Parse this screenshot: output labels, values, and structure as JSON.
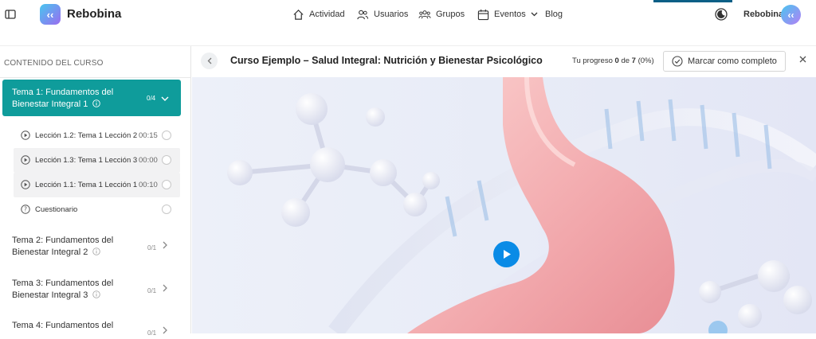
{
  "header": {
    "brand": "Rebobina",
    "nav": [
      {
        "label": "Actividad",
        "icon": "home-icon"
      },
      {
        "label": "Usuarios",
        "icon": "users-icon"
      },
      {
        "label": "Grupos",
        "icon": "groups-icon"
      },
      {
        "label": "Eventos",
        "icon": "calendar-icon"
      },
      {
        "label": "Blog",
        "icon": ""
      }
    ],
    "user_name": "Rebobina"
  },
  "sidebar": {
    "title": "CONTENIDO DEL CURSO",
    "active_topic": {
      "title": "Tema 1: Fundamentos del Bienestar Integral 1",
      "count": "0/4"
    },
    "lessons": [
      {
        "label": "Lección 1.2: Tema 1 Lección 2",
        "duration": "00:15"
      },
      {
        "label": "Lección 1.3: Tema 1 Lección 3",
        "duration": "00:00"
      },
      {
        "label": "Lección 1.1: Tema 1 Lección 1",
        "duration": "00:10"
      },
      {
        "label": "Cuestionario",
        "duration": ""
      }
    ],
    "topics": [
      {
        "title": "Tema 2: Fundamentos del Bienestar Integral 2",
        "count": "0/1"
      },
      {
        "title": "Tema 3: Fundamentos del Bienestar Integral 3",
        "count": "0/1"
      },
      {
        "title": "Tema 4: Fundamentos del",
        "count": "0/1"
      }
    ]
  },
  "course": {
    "title": "Curso Ejemplo – Salud Integral: Nutrición y Bienestar Psicológico",
    "progress_prefix": "Tu progreso",
    "progress_done": "0",
    "progress_sep": "de",
    "progress_total": "7",
    "progress_percent": "(0%)",
    "complete_button": "Marcar como completo"
  },
  "colors": {
    "accent": "#0f9c9b",
    "play": "#0a8be6"
  }
}
